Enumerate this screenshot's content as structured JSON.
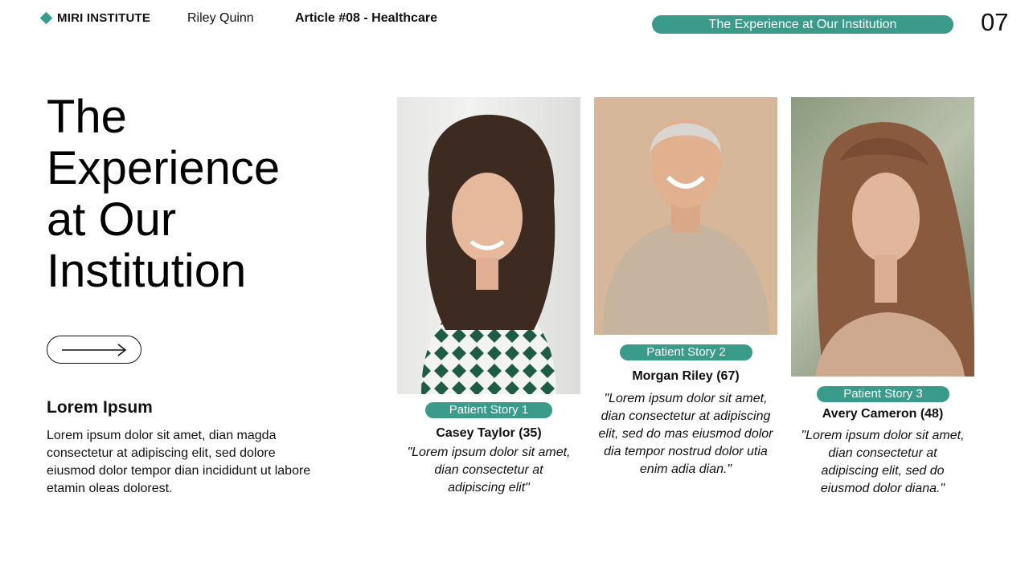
{
  "header": {
    "brand": "MIRI INSTITUTE",
    "author": "Riley Quinn",
    "article": "Article #08 - Healthcare",
    "section_pill": "The Experience at Our Institution",
    "page_number": "07"
  },
  "hero": {
    "title": "The\nExperience\nat Our\nInstitution"
  },
  "intro": {
    "heading": "Lorem Ipsum",
    "body": "Lorem ipsum dolor sit amet, dian magda consectetur at adipiscing elit, sed dolore eiusmod dolor tempor dian incididunt ut labore etamin oleas dolorest."
  },
  "stories": [
    {
      "tag": "Patient Story 1",
      "name": "Casey Taylor (35)",
      "quote": "\"Lorem ipsum dolor sit amet, dian consectetur at adipiscing elit\""
    },
    {
      "tag": "Patient Story 2",
      "name": "Morgan Riley (67)",
      "quote": "\"Lorem ipsum dolor sit amet, dian consectetur at adipiscing elit, sed do mas eiusmod dolor dia tempor nostrud dolor utia enim adia dian.\""
    },
    {
      "tag": "Patient Story 3",
      "name": "Avery Cameron (48)",
      "quote": "\"Lorem ipsum dolor sit amet, dian consectetur at adipiscing elit, sed do eiusmod dolor diana.\""
    }
  ],
  "colors": {
    "accent": "#3a9b8b",
    "text": "#111111",
    "background": "#ffffff"
  }
}
